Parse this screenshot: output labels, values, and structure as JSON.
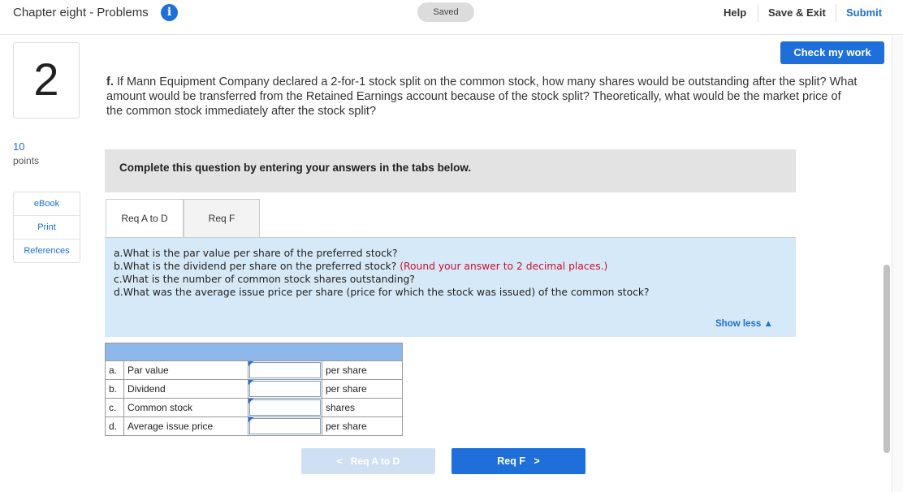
{
  "header": {
    "title": "Chapter eight - Problems",
    "info_icon": "info-icon",
    "saved_label": "Saved",
    "help_label": "Help",
    "save_exit_label": "Save & Exit",
    "submit_label": "Submit"
  },
  "question_meta": {
    "number": "2",
    "points_value": "10",
    "points_label": "points"
  },
  "sidebar": {
    "items": [
      {
        "label": "eBook"
      },
      {
        "label": "Print"
      },
      {
        "label": "References"
      }
    ]
  },
  "check_work_label": "Check my work",
  "question": {
    "part": "f.",
    "text": "If Mann Equipment Company declared a 2-for-1 stock split on the common stock, how many shares would be outstanding after the split? What amount would be transferred from the Retained Earnings account because of the stock split? Theoretically, what would be the market price of the common stock immediately after the stock split?"
  },
  "instruction": "Complete this question by entering your answers in the tabs below.",
  "tabs": [
    {
      "label": "Req A to D",
      "active": true
    },
    {
      "label": "Req F",
      "active": false
    }
  ],
  "requirements": {
    "a": "a.What is the par value per share of the preferred stock?",
    "b": "b.What is the dividend per share on the preferred stock?",
    "b_note": "(Round your answer to 2 decimal places.)",
    "c": "c.What is the number of common stock shares outstanding?",
    "d": "d.What was the average issue price per share (price for which the stock was issued) of the common stock?",
    "show_less": "Show less"
  },
  "answer_table": {
    "rows": [
      {
        "letter": "a.",
        "label": "Par value",
        "value": "",
        "unit": "per share"
      },
      {
        "letter": "b.",
        "label": "Dividend",
        "value": "",
        "unit": "per share"
      },
      {
        "letter": "c.",
        "label": "Common stock",
        "value": "",
        "unit": "shares"
      },
      {
        "letter": "d.",
        "label": "Average issue price",
        "value": "",
        "unit": "per share"
      }
    ]
  },
  "navigation": {
    "prev_label": "Req A to D",
    "next_label": "Req F"
  },
  "colors": {
    "accent": "#1e6fd9",
    "requirement_bg": "#d6e9f8",
    "table_header": "#8fb8ea",
    "note_red": "#c8102e"
  }
}
